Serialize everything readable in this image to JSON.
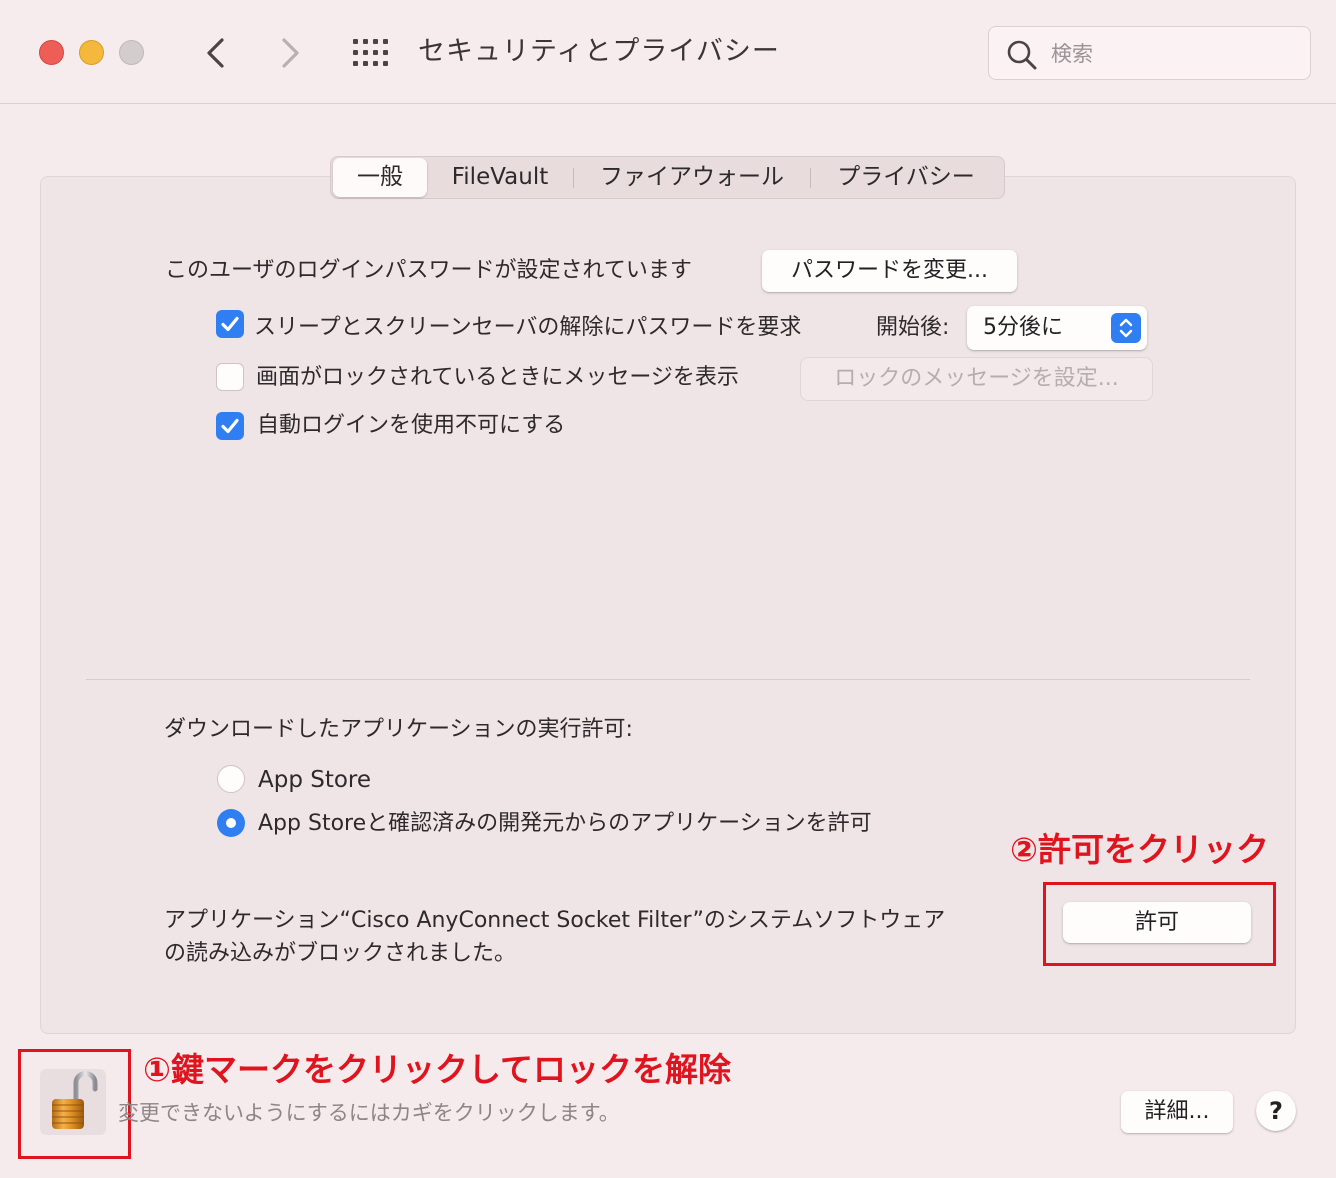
{
  "window": {
    "title": "セキュリティとプライバシー"
  },
  "search": {
    "placeholder": "検索"
  },
  "tabs": [
    {
      "label": "一般",
      "active": true
    },
    {
      "label": "FileVault",
      "active": false
    },
    {
      "label": "ファイアウォール",
      "active": false
    },
    {
      "label": "プライバシー",
      "active": false
    }
  ],
  "general": {
    "password_text": "このユーザのログインパスワードが設定されています",
    "change_password_button": "パスワードを変更...",
    "require_password": {
      "label": "スリープとスクリーンセーバの解除にパスワードを要求",
      "checked": true
    },
    "start_after_label": "開始後:",
    "start_after_value": "5分後に",
    "show_message": {
      "label": "画面がロックされているときにメッセージを表示",
      "checked": false
    },
    "set_lock_message_button": "ロックのメッセージを設定...",
    "disable_auto_login": {
      "label": "自動ログインを使用不可にする",
      "checked": true
    }
  },
  "downloads": {
    "heading": "ダウンロードしたアプリケーションの実行許可:",
    "options": [
      {
        "label": "App Store",
        "selected": false
      },
      {
        "label": "App Storeと確認済みの開発元からのアプリケーションを許可",
        "selected": true
      }
    ]
  },
  "blocked": {
    "line1": "アプリケーション“Cisco AnyConnect Socket Filter”のシステムソフトウェア",
    "line2": "の読み込みがブロックされました。",
    "allow_button": "許可"
  },
  "footer": {
    "lock_hint": "変更できないようにするにはカギをクリックします。",
    "advanced_button": "詳細...",
    "help_button": "?"
  },
  "annotations": {
    "step1": "①鍵マークをクリックしてロックを解除",
    "step2": "②許可をクリック"
  },
  "colors": {
    "accent": "#2f7ff3",
    "annotation": "#e0141e"
  }
}
